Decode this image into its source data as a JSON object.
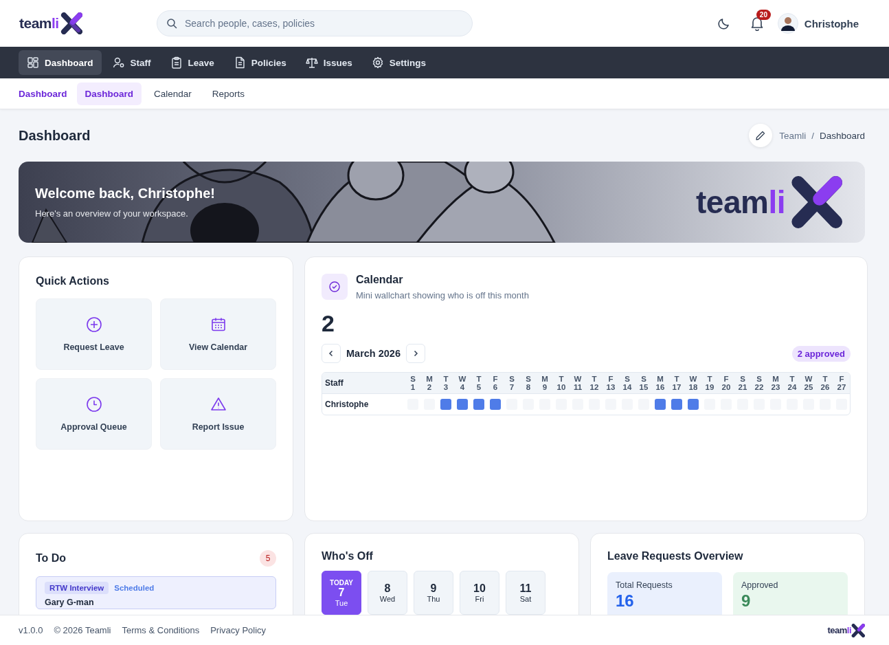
{
  "header": {
    "logo": {
      "part1": "team",
      "part2": "li"
    },
    "search": {
      "placeholder": "Search people, cases, policies"
    },
    "notifications": {
      "count": "20"
    },
    "user": {
      "name": "Christophe"
    }
  },
  "nav": [
    {
      "label": "Dashboard",
      "selected": true
    },
    {
      "label": "Staff",
      "selected": false
    },
    {
      "label": "Leave",
      "selected": false
    },
    {
      "label": "Policies",
      "selected": false
    },
    {
      "label": "Issues",
      "selected": false
    },
    {
      "label": "Settings",
      "selected": false
    }
  ],
  "subnav": {
    "section": "Dashboard",
    "tabs": [
      {
        "label": "Dashboard",
        "selected": true
      },
      {
        "label": "Calendar",
        "selected": false
      },
      {
        "label": "Reports",
        "selected": false
      }
    ]
  },
  "page": {
    "title": "Dashboard",
    "breadcrumb": [
      "Teamli",
      "Dashboard"
    ],
    "separator": "/"
  },
  "banner": {
    "title": "Welcome back, Christophe!",
    "subtitle": "Here's an overview of your workspace.",
    "logo": {
      "part1": "team",
      "part2": "li"
    }
  },
  "quick_actions": {
    "title": "Quick Actions",
    "items": [
      {
        "label": "Request Leave"
      },
      {
        "label": "View Calendar"
      },
      {
        "label": "Approval Queue"
      },
      {
        "label": "Report Issue"
      }
    ]
  },
  "calendar": {
    "title": "Calendar",
    "subtitle": "Mini wallchart showing who is off this month",
    "count": "2",
    "month": "March 2026",
    "badge": "2 approved",
    "staff_header": "Staff",
    "days": [
      {
        "w": "S",
        "d": "1"
      },
      {
        "w": "M",
        "d": "2"
      },
      {
        "w": "T",
        "d": "3"
      },
      {
        "w": "W",
        "d": "4"
      },
      {
        "w": "T",
        "d": "5"
      },
      {
        "w": "F",
        "d": "6"
      },
      {
        "w": "S",
        "d": "7"
      },
      {
        "w": "S",
        "d": "8"
      },
      {
        "w": "M",
        "d": "9"
      },
      {
        "w": "T",
        "d": "10"
      },
      {
        "w": "W",
        "d": "11"
      },
      {
        "w": "T",
        "d": "12"
      },
      {
        "w": "F",
        "d": "13"
      },
      {
        "w": "S",
        "d": "14"
      },
      {
        "w": "S",
        "d": "15"
      },
      {
        "w": "M",
        "d": "16"
      },
      {
        "w": "T",
        "d": "17"
      },
      {
        "w": "W",
        "d": "18"
      },
      {
        "w": "T",
        "d": "19"
      },
      {
        "w": "F",
        "d": "20"
      },
      {
        "w": "S",
        "d": "21"
      },
      {
        "w": "S",
        "d": "22"
      },
      {
        "w": "M",
        "d": "23"
      },
      {
        "w": "T",
        "d": "24"
      },
      {
        "w": "W",
        "d": "25"
      },
      {
        "w": "T",
        "d": "26"
      },
      {
        "w": "F",
        "d": "27"
      }
    ],
    "rows": [
      {
        "name": "Christophe",
        "off": [
          false,
          false,
          true,
          true,
          true,
          true,
          false,
          false,
          false,
          false,
          false,
          false,
          false,
          false,
          false,
          true,
          true,
          true,
          false,
          false,
          false,
          false,
          false,
          false,
          false,
          false,
          false
        ]
      }
    ]
  },
  "todo": {
    "title": "To Do",
    "count": "5",
    "items": [
      {
        "tag": "RTW Interview",
        "status": "Scheduled",
        "name": "Gary G-man"
      }
    ]
  },
  "whos_off": {
    "title": "Who's Off",
    "days": [
      {
        "top": "TODAY",
        "num": "7",
        "day": "Tue",
        "selected": true
      },
      {
        "num": "8",
        "day": "Wed",
        "selected": false
      },
      {
        "num": "9",
        "day": "Thu",
        "selected": false
      },
      {
        "num": "10",
        "day": "Fri",
        "selected": false
      },
      {
        "num": "11",
        "day": "Sat",
        "selected": false
      }
    ]
  },
  "leave_overview": {
    "title": "Leave Requests Overview",
    "stats": [
      {
        "label": "Total Requests",
        "value": "16",
        "kind": "total"
      },
      {
        "label": "Approved",
        "value": "9",
        "kind": "approved"
      }
    ]
  },
  "footer": {
    "version": "v1.0.0",
    "copyright": "© 2026 Teamli",
    "links": [
      "Terms & Conditions",
      "Privacy Policy"
    ],
    "logo": {
      "part1": "team",
      "part2": "li"
    }
  }
}
